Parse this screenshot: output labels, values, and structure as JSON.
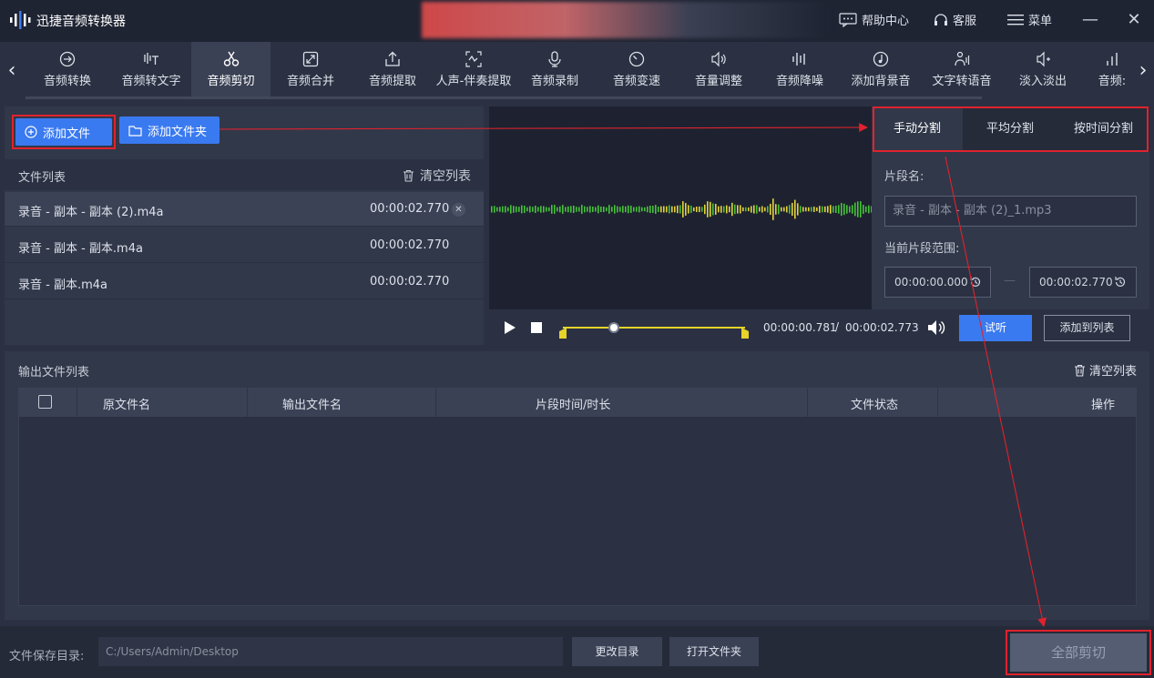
{
  "app": {
    "title": "迅捷音频转换器"
  },
  "titlebar": {
    "help_label": "帮助中心",
    "service_label": "客服",
    "menu_label": "菜单",
    "minimize": "—",
    "close": "✕"
  },
  "tools": [
    {
      "label": "音频转换",
      "icon": "audio-convert-icon"
    },
    {
      "label": "音频转文字",
      "icon": "speech-to-text-icon"
    },
    {
      "label": "音频剪切",
      "icon": "scissors-icon"
    },
    {
      "label": "音频合并",
      "icon": "merge-icon"
    },
    {
      "label": "音频提取",
      "icon": "extract-icon"
    },
    {
      "label": "人声-伴奏提取",
      "icon": "vocal-extract-icon"
    },
    {
      "label": "音频录制",
      "icon": "microphone-icon"
    },
    {
      "label": "音频变速",
      "icon": "speed-icon"
    },
    {
      "label": "音量调整",
      "icon": "volume-icon"
    },
    {
      "label": "音频降噪",
      "icon": "denoise-icon"
    },
    {
      "label": "添加背景音",
      "icon": "background-music-icon"
    },
    {
      "label": "文字转语音",
      "icon": "text-to-speech-icon"
    },
    {
      "label": "淡入淡出",
      "icon": "fade-icon"
    },
    {
      "label": "音频:",
      "icon": "bars-icon"
    }
  ],
  "active_tool": "音频剪切",
  "left": {
    "add_file": "添加文件",
    "add_folder": "添加文件夹",
    "file_list_label": "文件列表",
    "clear_list": "清空列表",
    "files": [
      {
        "name": "录音 - 副本 - 副本 (2).m4a",
        "duration": "00:00:02.770"
      },
      {
        "name": "录音 - 副本 - 副本.m4a",
        "duration": "00:00:02.770"
      },
      {
        "name": "录音 - 副本.m4a",
        "duration": "00:00:02.770"
      }
    ]
  },
  "split": {
    "tabs": [
      "手动分割",
      "平均分割",
      "按时间分割"
    ],
    "segment_name_label": "片段名:",
    "segment_name_placeholder": "录音 - 副本 - 副本 (2)_1.mp3",
    "range_label": "当前片段范围:",
    "range_start": "00:00:00.000",
    "range_sep": "—",
    "range_end": "00:00:02.770"
  },
  "player": {
    "time_current": "00:00:00.781",
    "time_sep": "/",
    "time_total": "00:00:02.773",
    "progress": 0.28,
    "preview_label": "试听",
    "add_to_list_label": "添加到列表"
  },
  "output": {
    "label": "输出文件列表",
    "clear_list": "清空列表",
    "columns": [
      "原文件名",
      "输出文件名",
      "片段时间/时长",
      "文件状态",
      "操作"
    ]
  },
  "bottom": {
    "save_dir_label": "文件保存目录:",
    "save_path": "C:/Users/Admin/Desktop",
    "change_dir": "更改目录",
    "open_folder": "打开文件夹",
    "cut_all": "全部剪切"
  },
  "colors": {
    "accent_blue": "#3a7af0",
    "annotation_red": "#e0222e",
    "wave_green": "#47c23a",
    "wave_yellow": "#e4d23a"
  }
}
